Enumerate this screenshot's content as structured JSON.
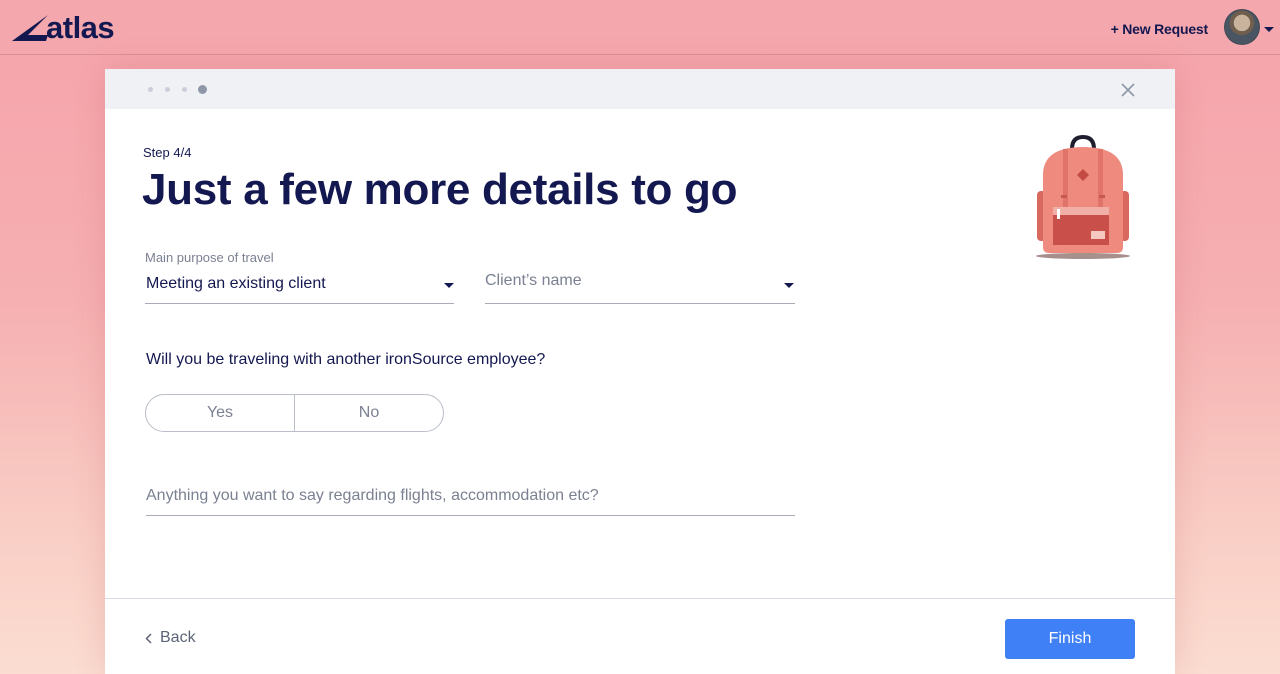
{
  "app": {
    "logo_text": "atlas"
  },
  "header": {
    "new_request_label": "+ New Request",
    "avatar_icon": "user-avatar",
    "menu_icon": "caret-down"
  },
  "wizard": {
    "steps_total": 4,
    "current_step": 4,
    "step_label": "Step 4/4",
    "title": "Just a few more details to go",
    "close_icon": "close-x"
  },
  "form": {
    "purpose": {
      "label": "Main purpose of travel",
      "value": "Meeting an existing client"
    },
    "client": {
      "placeholder": "Client’s name"
    },
    "companion": {
      "question": "Will you be traveling with another ironSource employee?",
      "options": [
        "Yes",
        "No"
      ]
    },
    "notes": {
      "placeholder": "Anything you want to say regarding flights, accommodation etc?"
    }
  },
  "footer": {
    "back_label": "Back",
    "finish_label": "Finish"
  },
  "colors": {
    "primary_text": "#141850",
    "accent_button": "#3f80f7",
    "backpack": "#ef8a7e"
  }
}
